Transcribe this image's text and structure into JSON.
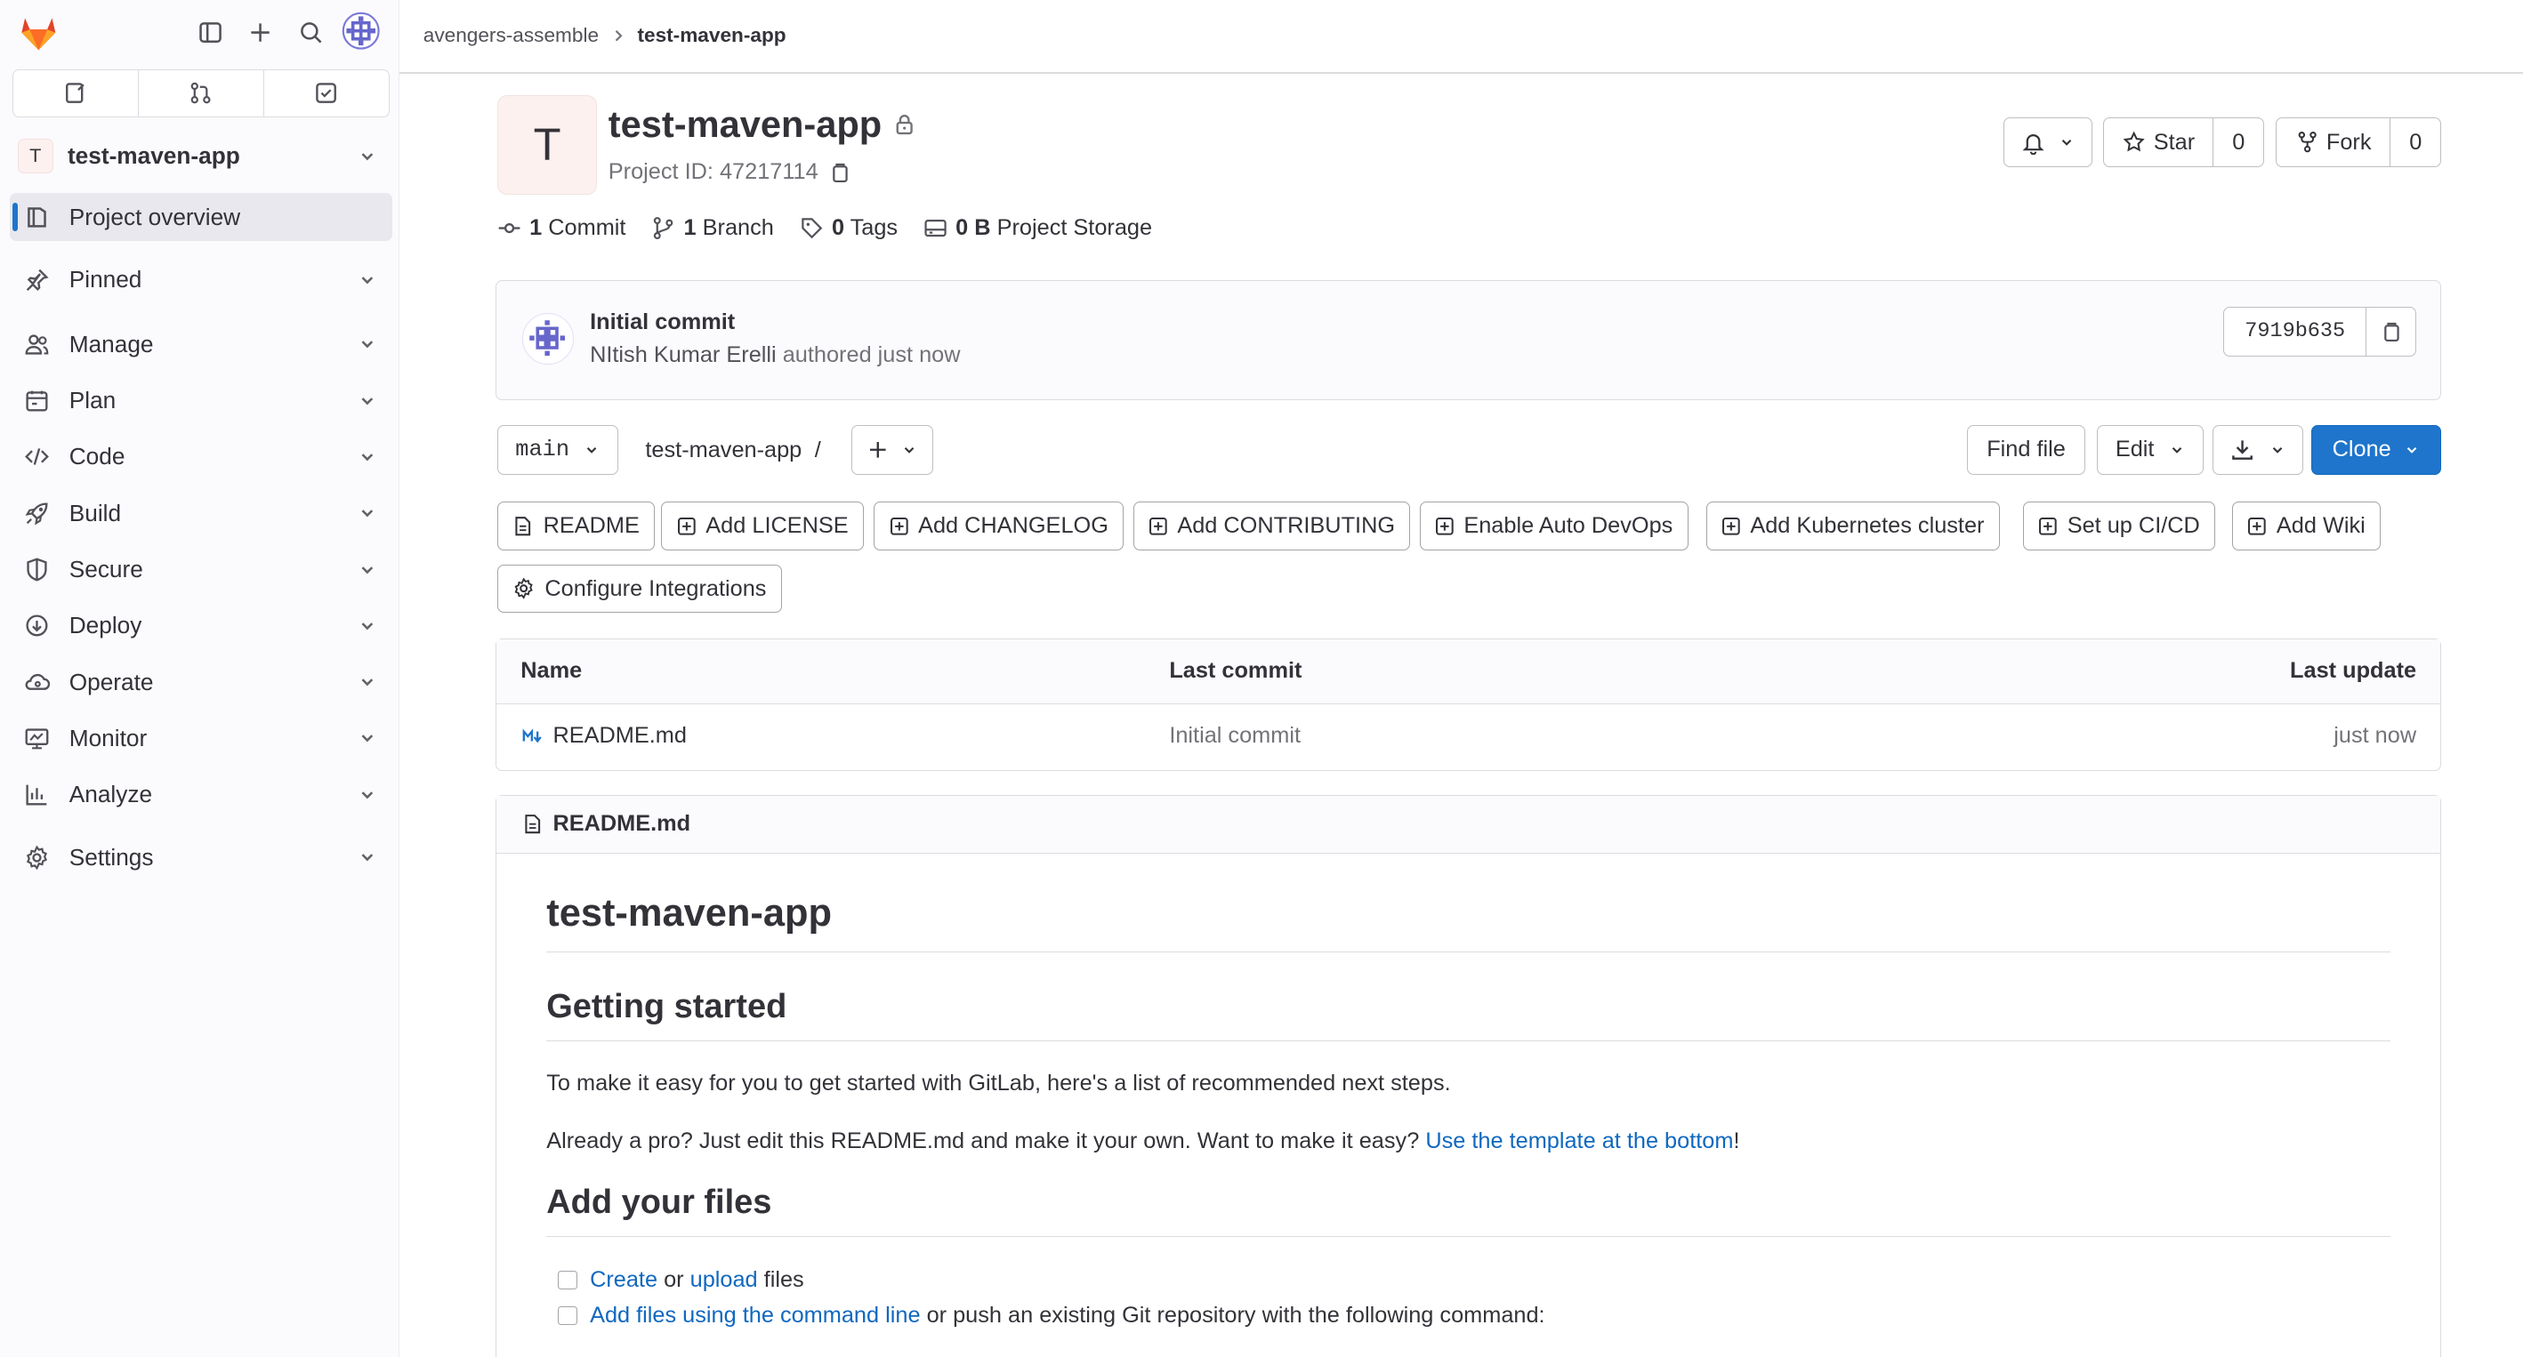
{
  "sidebar": {
    "project_initial": "T",
    "project_name": "test-maven-app",
    "items": [
      {
        "label": "Project overview",
        "icon": "project-icon"
      },
      {
        "label": "Pinned",
        "icon": "pin-icon"
      },
      {
        "label": "Manage",
        "icon": "users-icon"
      },
      {
        "label": "Plan",
        "icon": "planning-icon"
      },
      {
        "label": "Code",
        "icon": "code-icon"
      },
      {
        "label": "Build",
        "icon": "rocket-icon"
      },
      {
        "label": "Secure",
        "icon": "shield-icon"
      },
      {
        "label": "Deploy",
        "icon": "deployments-icon"
      },
      {
        "label": "Operate",
        "icon": "cloud-gear-icon"
      },
      {
        "label": "Monitor",
        "icon": "monitor-icon"
      },
      {
        "label": "Analyze",
        "icon": "chart-icon"
      },
      {
        "label": "Settings",
        "icon": "settings-icon"
      }
    ]
  },
  "breadcrumb": {
    "group": "avengers-assemble",
    "project": "test-maven-app"
  },
  "project": {
    "initial": "T",
    "name": "test-maven-app",
    "id_label": "Project ID: 47217114",
    "star_label": "Star",
    "star_count": "0",
    "fork_label": "Fork",
    "fork_count": "0"
  },
  "stats": {
    "commits_n": "1",
    "commits_label": "Commit",
    "branches_n": "1",
    "branches_label": "Branch",
    "tags_n": "0",
    "tags_label": "Tags",
    "storage_n": "0 B",
    "storage_label": "Project Storage"
  },
  "last_commit": {
    "title": "Initial commit",
    "author": "NItish Kumar Erelli",
    "authored": "authored just now",
    "sha": "7919b635"
  },
  "repo_toolbar": {
    "branch": "main",
    "path": "test-maven-app",
    "sep": "/",
    "find_file": "Find file",
    "edit": "Edit",
    "clone": "Clone"
  },
  "quick_actions": [
    "README",
    "Add LICENSE",
    "Add CHANGELOG",
    "Add CONTRIBUTING",
    "Enable Auto DevOps",
    "Add Kubernetes cluster",
    "Set up CI/CD",
    "Add Wiki",
    "Configure Integrations"
  ],
  "file_table": {
    "headers": {
      "name": "Name",
      "last_commit": "Last commit",
      "last_update": "Last update"
    },
    "rows": [
      {
        "name": "README.md",
        "last_commit": "Initial commit",
        "last_update": "just now"
      }
    ]
  },
  "readme": {
    "filename": "README.md",
    "h1": "test-maven-app",
    "h2_getting_started": "Getting started",
    "p1": "To make it easy for you to get started with GitLab, here's a list of recommended next steps.",
    "p2_pre": "Already a pro? Just edit this README.md and make it your own. Want to make it easy? ",
    "p2_link": "Use the template at the bottom",
    "p2_post": "!",
    "h2_add_files": "Add your files",
    "task1_link1": "Create",
    "task1_mid": " or ",
    "task1_link2": "upload",
    "task1_post": " files",
    "task2_link": "Add files using the command line",
    "task2_post": " or push an existing Git repository with the following command:"
  },
  "colors": {
    "brand_orange": "#fc6d26",
    "primary_blue": "#1f75cb",
    "link_blue": "#1068bf",
    "sidebar_bg": "#fbfafd"
  }
}
